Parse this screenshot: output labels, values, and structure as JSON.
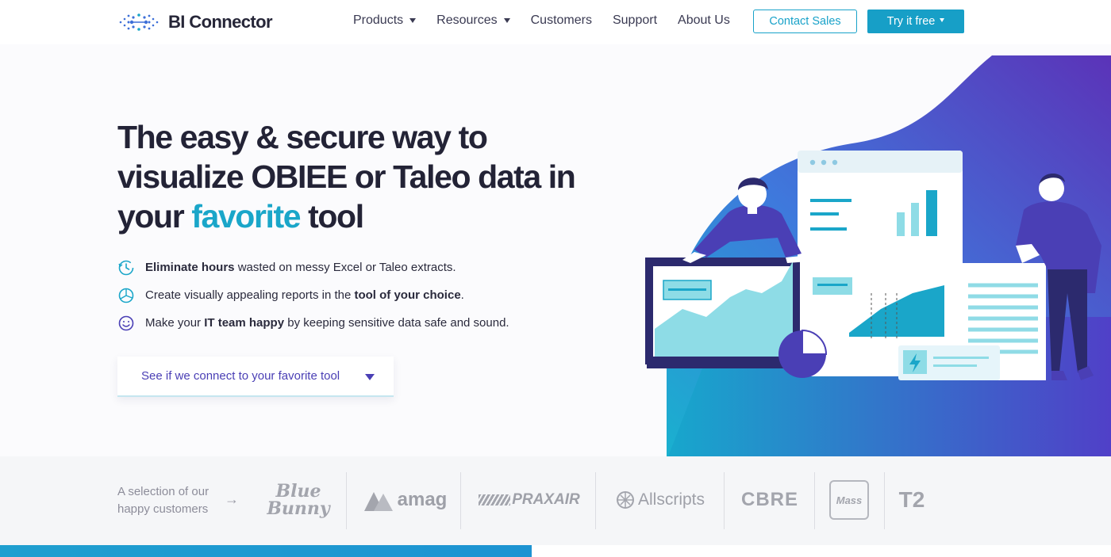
{
  "brand": {
    "name": "BI Connector"
  },
  "nav": {
    "items": [
      {
        "label": "Products",
        "has_caret": true
      },
      {
        "label": "Resources",
        "has_caret": true
      },
      {
        "label": "Customers",
        "has_caret": false
      },
      {
        "label": "Support",
        "has_caret": false
      },
      {
        "label": "About Us",
        "has_caret": false
      }
    ],
    "contact_label": "Contact Sales",
    "try_label": "Try it free"
  },
  "hero": {
    "title_line1": "The easy & secure way to",
    "title_line2": "visualize OBIEE or Taleo data in",
    "title_line3_pre": "your",
    "title_line3_accent": "favorite",
    "title_line3_post": "tool",
    "bullets": [
      {
        "icon": "clock-icon",
        "bold": "Eliminate hours",
        "text": " wasted on messy Excel or Taleo extracts."
      },
      {
        "icon": "pie-chart-icon",
        "pre": "Create visually appealing reports in the ",
        "bold": "tool of your choice",
        "post": "."
      },
      {
        "icon": "smiley-icon",
        "pre": "Make your ",
        "bold": "IT team happy",
        "post": " by keeping sensitive data safe and sound."
      }
    ],
    "dropdown_label": "See if we connect to your favorite tool"
  },
  "customers": {
    "label_line1": "A selection of our",
    "label_line2": "happy customers",
    "arrow": "→",
    "logos": [
      "Blue Bunny",
      "amag",
      "PRAXAIR",
      "Allscripts",
      "CBRE",
      "Mass",
      "T2"
    ]
  },
  "colors": {
    "accent": "#1aa6c9",
    "primary_button": "#179fc7",
    "purple": "#4a3fb5",
    "heading": "#232336"
  }
}
